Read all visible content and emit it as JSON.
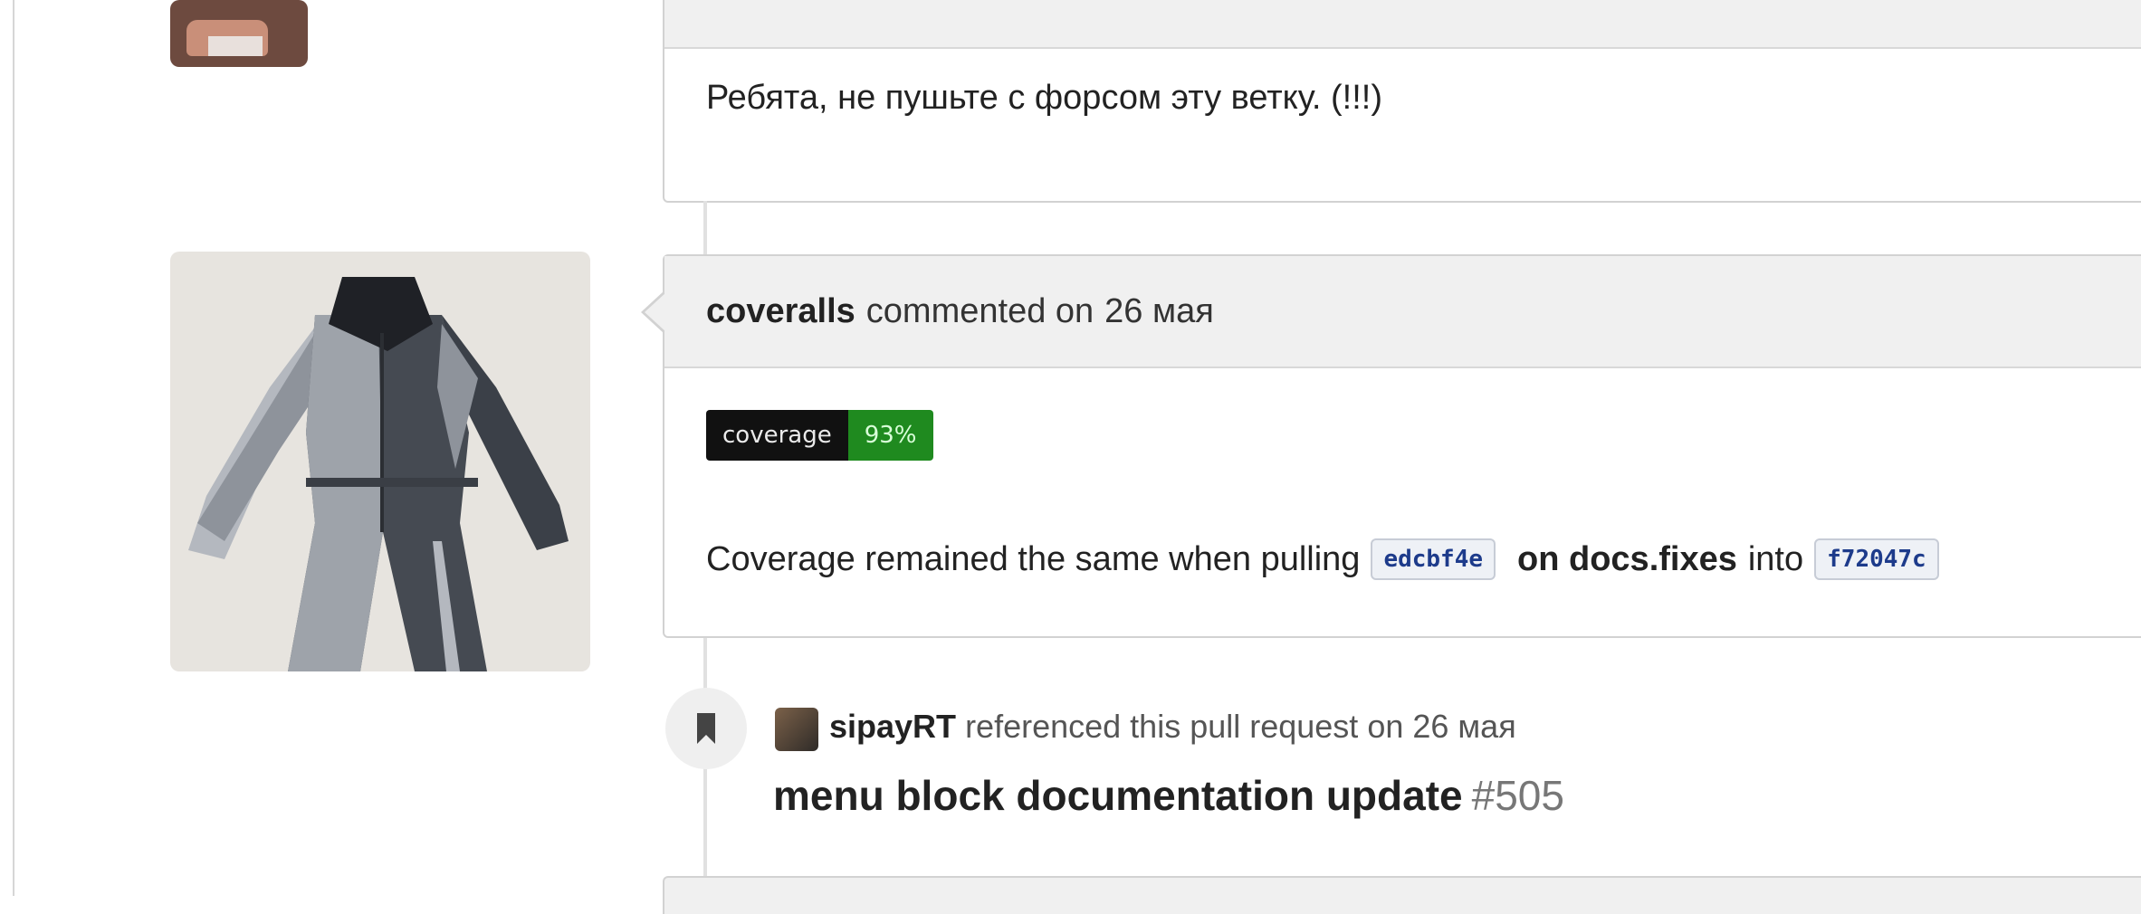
{
  "prev_comment": {
    "body": "Ребята, не пушьте с форсом эту ветку. (!!!)"
  },
  "coveralls_comment": {
    "author": "coveralls",
    "action": "commented on",
    "date": "26 мая",
    "badge": {
      "label": "coverage",
      "value": "93%"
    },
    "text_before": "Coverage remained the same when pulling",
    "sha_from": "edcbf4e",
    "branch_part": "on docs.fixes",
    "into_word": "into",
    "sha_to": "f72047c"
  },
  "reference_event": {
    "user": "sipayRT",
    "action": "referenced this pull request on",
    "date": "26 мая",
    "title": "menu block documentation update",
    "number": "#505"
  },
  "colors": {
    "badge_label_bg": "#111111",
    "badge_value_bg": "#1f8a1f",
    "header_bg": "#f0f0f0",
    "border": "#d2d2d2"
  },
  "icons": {
    "reference_icon": "bookmark-icon"
  }
}
